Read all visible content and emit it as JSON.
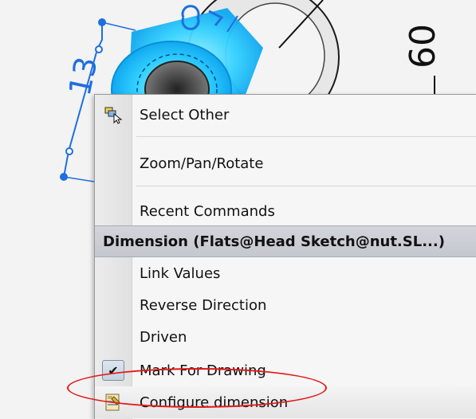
{
  "viewport": {
    "dimension_values": [
      "13",
      "60"
    ]
  },
  "context_menu": {
    "items_top": [
      {
        "label": "Select Other",
        "icon": "select-other-icon"
      },
      {
        "label": "Zoom/Pan/Rotate",
        "icon": ""
      },
      {
        "label": "Recent Commands",
        "icon": ""
      }
    ],
    "section_header": "Dimension (Flats@Head Sketch@nut.SL...)",
    "items_bottom": [
      {
        "label": "Link Values"
      },
      {
        "label": "Reverse Direction"
      },
      {
        "label": "Driven"
      },
      {
        "label": "Mark For Drawing",
        "checked": true,
        "check_glyph": "✔"
      },
      {
        "label": "Configure dimension",
        "icon": "configure-dimension-icon"
      }
    ]
  },
  "annotation": {
    "target": "Configure dimension",
    "color": "#e21a1a"
  }
}
